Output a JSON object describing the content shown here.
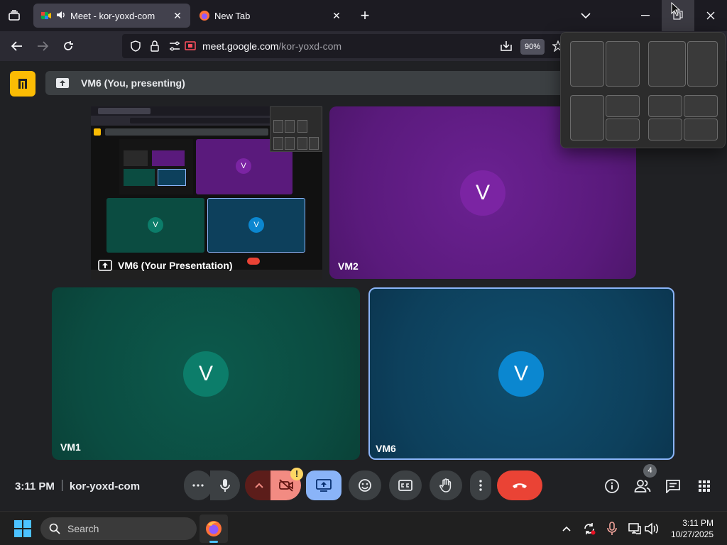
{
  "browser": {
    "tabs": [
      {
        "title": "Meet - kor-yoxd-com",
        "active": true
      },
      {
        "title": "New Tab",
        "active": false
      }
    ],
    "url": {
      "host": "meet.google.com",
      "path": "/kor-yoxd-com"
    },
    "zoom": "90%"
  },
  "meet": {
    "presenting_banner": "VM6 (You, presenting)",
    "tiles": {
      "presentation": {
        "label": "VM6 (Your Presentation)"
      },
      "vm2": {
        "label": "VM2",
        "initial": "V",
        "avatar_color": "#7b24a3"
      },
      "vm1": {
        "label": "VM1",
        "initial": "V",
        "avatar_color": "#0c7d6a"
      },
      "vm6": {
        "label": "VM6",
        "initial": "V",
        "avatar_color": "#0b87d0"
      }
    },
    "mini_screen": {
      "tiles": [
        {
          "initial": "V"
        },
        {
          "initial": "V"
        },
        {
          "initial": "V"
        }
      ]
    },
    "footer": {
      "time": "3:11 PM",
      "meeting_code": "kor-yoxd-com",
      "camera_warning": "!",
      "people_count": "4"
    }
  },
  "taskbar": {
    "search_placeholder": "Search",
    "time": "3:11 PM",
    "date": "10/27/2025"
  },
  "colors": {
    "accent": "#8ab4f8",
    "end_call": "#ea4335",
    "present_active": "#8ab4f8",
    "camera_off": "#f28b82",
    "logo_yellow": "#fbbc04"
  }
}
